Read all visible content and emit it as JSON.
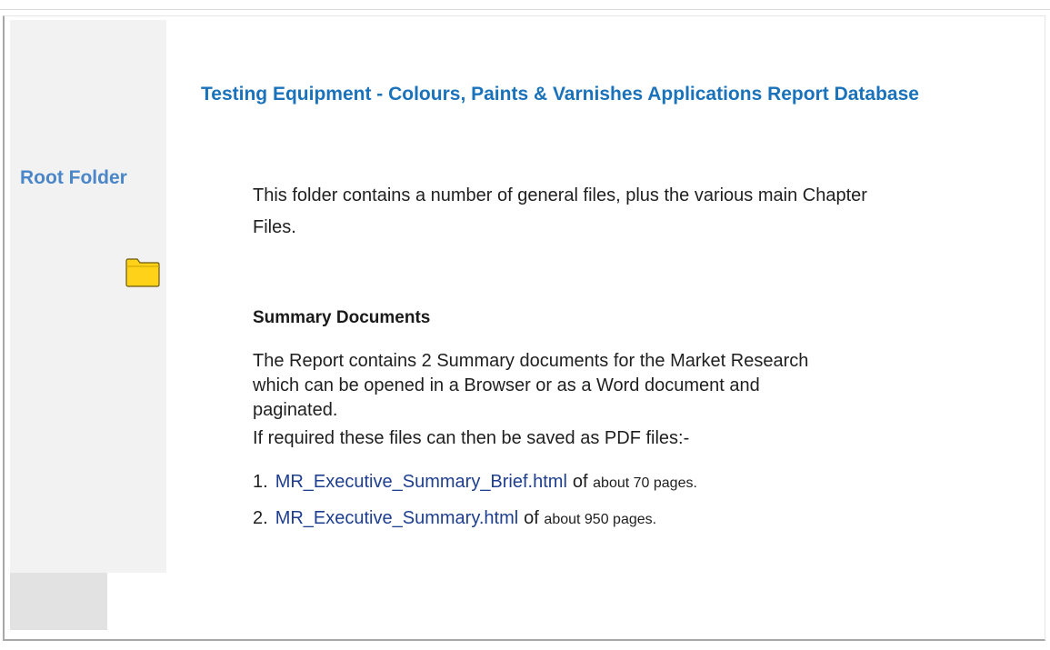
{
  "sidebar": {
    "root_folder_label": "Root Folder",
    "folder_icon": "folder-icon",
    "folder_icon_color": "#ffd21a"
  },
  "main": {
    "title": "Testing Equipment - Colours, Paints & Varnishes Applications Report Database",
    "intro": "This folder contains a number of general files, plus the various main Chapter Files.",
    "summary_heading": "Summary Documents",
    "summary_description": "The Report contains 2 Summary documents for the Market Research which can be opened in a Browser or as a Word document and paginated.",
    "pdf_note": "If required these files can then be saved as PDF files:-",
    "documents": [
      {
        "number": "1.",
        "link": "MR_Executive_Summary_Brief.html",
        "of": "of",
        "size": "about 70 pages."
      },
      {
        "number": "2.",
        "link": "MR_Executive_Summary.html",
        "of": "of",
        "size": "about 950 pages."
      }
    ]
  },
  "colors": {
    "title": "#1a72bb",
    "sidebar_label": "#4a86c8",
    "link": "#1e3f8f",
    "sidebar_bg": "#f2f2f2"
  }
}
